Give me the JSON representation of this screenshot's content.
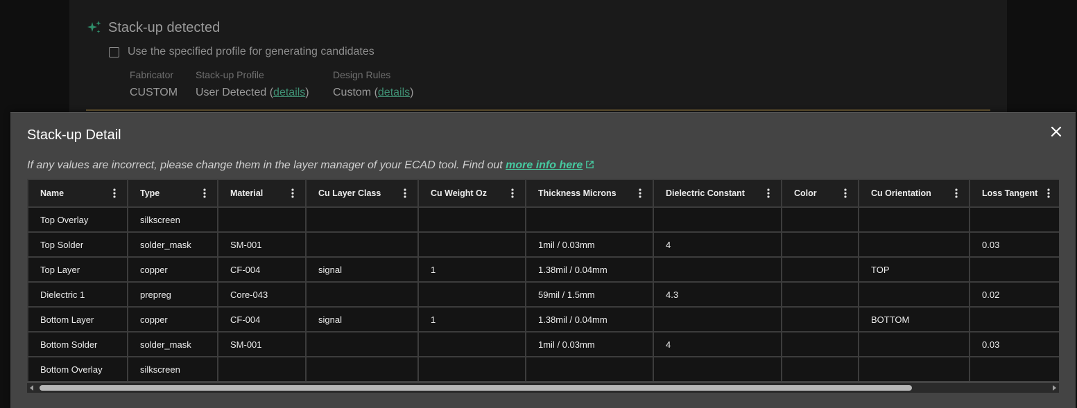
{
  "background": {
    "section_title": "Stack-up detected",
    "checkbox_label": "Use the specified profile for generating candidates",
    "fabricator": {
      "label": "Fabricator",
      "value": "CUSTOM"
    },
    "stackup_profile": {
      "label": "Stack-up Profile",
      "value": "User Detected",
      "link": "details"
    },
    "design_rules": {
      "label": "Design Rules",
      "value": "Custom",
      "link": "details"
    },
    "accent_color": "#2f8f6b"
  },
  "modal": {
    "title": "Stack-up Detail",
    "notice_text": "If any values are incorrect, please change them in the layer manager of your ECAD tool. Find out ",
    "notice_link": "more info here",
    "link_color": "#47c9a0"
  },
  "table": {
    "columns": [
      "Name",
      "Type",
      "Material",
      "Cu Layer Class",
      "Cu Weight Oz",
      "Thickness Microns",
      "Dielectric Constant",
      "Color",
      "Cu Orientation",
      "Loss Tangent"
    ],
    "rows": [
      [
        "Top Overlay",
        "silkscreen",
        "",
        "",
        "",
        "",
        "",
        "",
        "",
        ""
      ],
      [
        "Top Solder",
        "solder_mask",
        "SM-001",
        "",
        "",
        "1mil / 0.03mm",
        "4",
        "",
        "",
        "0.03"
      ],
      [
        "Top Layer",
        "copper",
        "CF-004",
        "signal",
        "1",
        "1.38mil / 0.04mm",
        "",
        "",
        "TOP",
        ""
      ],
      [
        "Dielectric 1",
        "prepreg",
        "Core-043",
        "",
        "",
        "59mil / 1.5mm",
        "4.3",
        "",
        "",
        "0.02"
      ],
      [
        "Bottom Layer",
        "copper",
        "CF-004",
        "signal",
        "1",
        "1.38mil / 0.04mm",
        "",
        "",
        "BOTTOM",
        ""
      ],
      [
        "Bottom Solder",
        "solder_mask",
        "SM-001",
        "",
        "",
        "1mil / 0.03mm",
        "4",
        "",
        "",
        "0.03"
      ],
      [
        "Bottom Overlay",
        "silkscreen",
        "",
        "",
        "",
        "",
        "",
        "",
        "",
        ""
      ]
    ]
  }
}
